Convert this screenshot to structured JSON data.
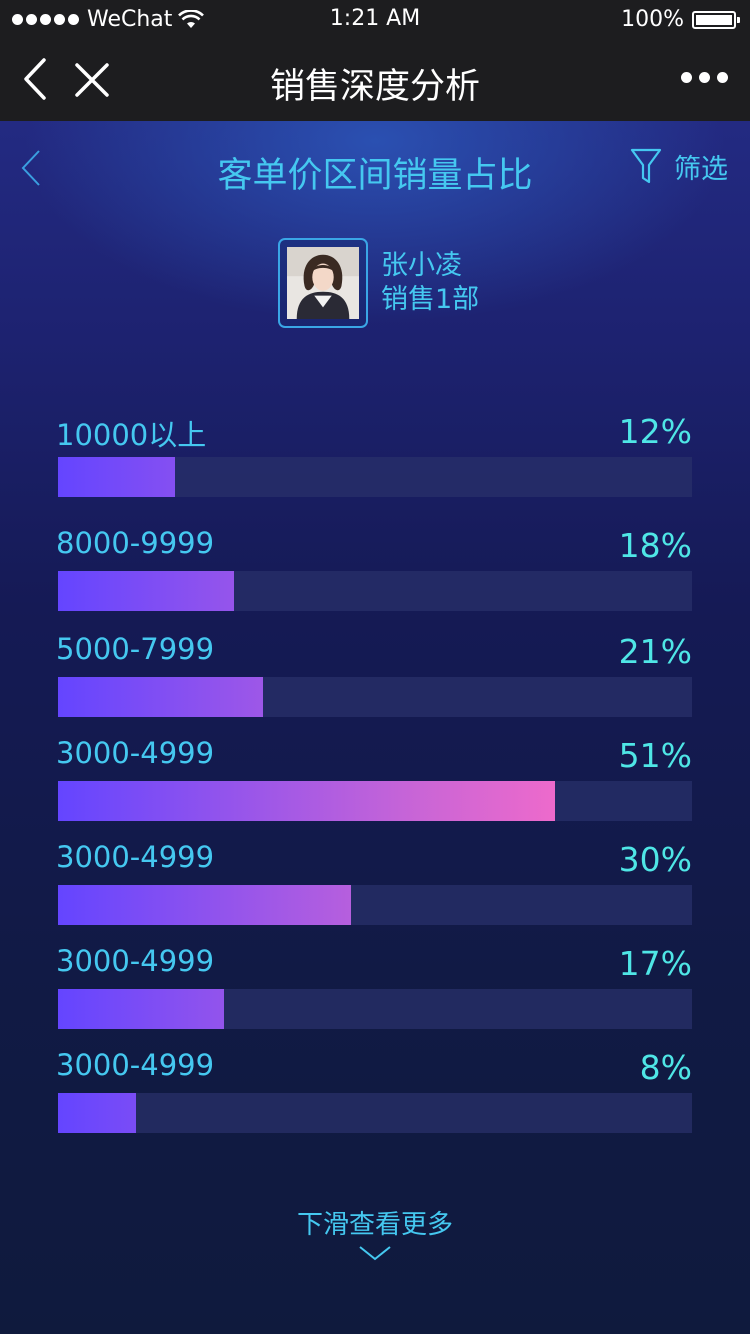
{
  "status_bar": {
    "carrier": "WeChat",
    "time": "1:21 AM",
    "battery": "100%"
  },
  "nav": {
    "title": "销售深度分析"
  },
  "page": {
    "title": "客单价区间销量占比",
    "filter_label": "筛选"
  },
  "profile": {
    "name": "张小凌",
    "department": "销售1部"
  },
  "chart_data": {
    "type": "bar",
    "orientation": "horizontal",
    "categories": [
      "10000以上",
      "8000-9999",
      "5000-7999",
      "3000-4999",
      "3000-4999",
      "3000-4999",
      "3000-4999"
    ],
    "values": [
      12,
      18,
      21,
      51,
      30,
      17,
      8
    ],
    "value_labels": [
      "12%",
      "18%",
      "21%",
      "51%",
      "30%",
      "17%",
      "8%"
    ],
    "xlim": [
      0,
      65
    ],
    "colors": {
      "start": "#6445ff",
      "end": "#ee6acb",
      "track": "#283069"
    }
  },
  "footer": {
    "more_label": "下滑查看更多"
  },
  "icons": [
    "back-icon",
    "close-icon",
    "more-icon",
    "filter-icon",
    "chevron-down-icon"
  ]
}
